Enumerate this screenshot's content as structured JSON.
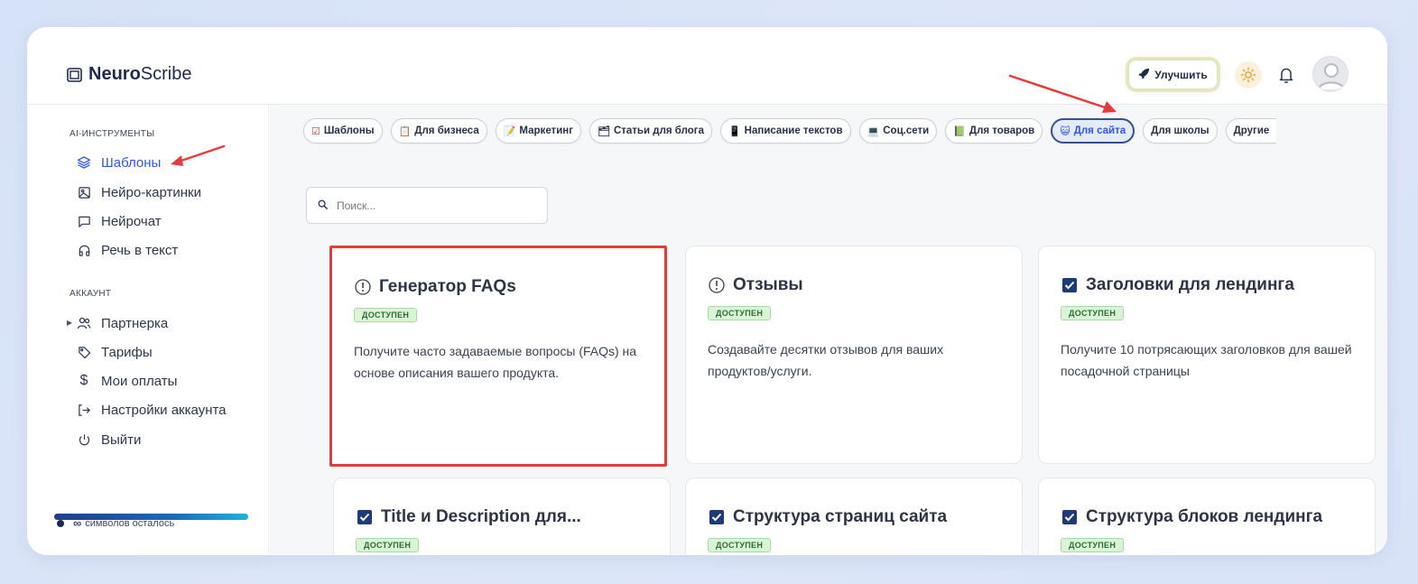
{
  "app": {
    "logo_bold": "Neuro",
    "logo_light": "Scribe"
  },
  "header": {
    "upgrade_label": "Улучшить"
  },
  "sidebar": {
    "section_tools": "AI-ИНСТРУМЕНТЫ",
    "tools": [
      {
        "label": "Шаблоны",
        "icon": "layers-icon",
        "active": true
      },
      {
        "label": "Нейро-картинки",
        "icon": "image-icon"
      },
      {
        "label": "Нейрочат",
        "icon": "chat-icon"
      },
      {
        "label": "Речь в текст",
        "icon": "headphones-icon"
      }
    ],
    "section_account": "АККАУНТ",
    "account": [
      {
        "label": "Партнерка",
        "icon": "users-icon"
      },
      {
        "label": "Тарифы",
        "icon": "tag-icon"
      },
      {
        "label": "Мои оплаты",
        "icon": "dollar-icon"
      },
      {
        "label": "Настройки аккаунта",
        "icon": "logout-arrow-icon"
      },
      {
        "label": "Выйти",
        "icon": "power-icon"
      }
    ],
    "credits_symbol": "∞",
    "credits_text": "символов осталось"
  },
  "categories": [
    {
      "emoji": "☑",
      "label": "Шаблоны"
    },
    {
      "emoji": "📋",
      "label": "Для бизнеса"
    },
    {
      "emoji": "📝",
      "label": "Маркетинг"
    },
    {
      "emoji": "🗂",
      "label": "Статьи для блога"
    },
    {
      "emoji": "📱",
      "label": "Написание текстов"
    },
    {
      "emoji": "💻",
      "label": "Соц.сети"
    },
    {
      "emoji": "📗",
      "label": "Для товаров"
    },
    {
      "emoji": "😺",
      "label": "Для сайта",
      "active": true
    },
    {
      "emoji": "",
      "label": "Для школы"
    },
    {
      "emoji": "",
      "label": "Другие"
    }
  ],
  "search": {
    "placeholder": "Поиск..."
  },
  "cards": [
    {
      "title": "Генератор FAQs",
      "icon": "info-circle-icon",
      "badge": "ДОСТУПЕН",
      "desc": "Получите часто задаваемые вопросы (FAQs) на основе описания вашего продукта."
    },
    {
      "title": "Отзывы",
      "icon": "info-circle-icon",
      "badge": "ДОСТУПЕН",
      "desc": "Создавайте десятки отзывов для ваших продуктов/услуги."
    },
    {
      "title": "Заголовки для лендинга",
      "icon": "checkbox-icon",
      "badge": "ДОСТУПЕН",
      "desc": "Получите 10 потрясающих заголовков для вашей посадочной страницы"
    },
    {
      "title": "Title и Description для...",
      "icon": "checkbox-icon",
      "badge": "ДОСТУПЕН",
      "desc": ""
    },
    {
      "title": "Структура страниц сайта",
      "icon": "checkbox-icon",
      "badge": "ДОСТУПЕН",
      "desc": ""
    },
    {
      "title": "Структура блоков лендинга",
      "icon": "checkbox-icon",
      "badge": "ДОСТУПЕН",
      "desc": ""
    }
  ],
  "colors": {
    "accent": "#2f57e6",
    "annotation": "#e53b3b",
    "badge_bg": "#d9f5d6"
  }
}
